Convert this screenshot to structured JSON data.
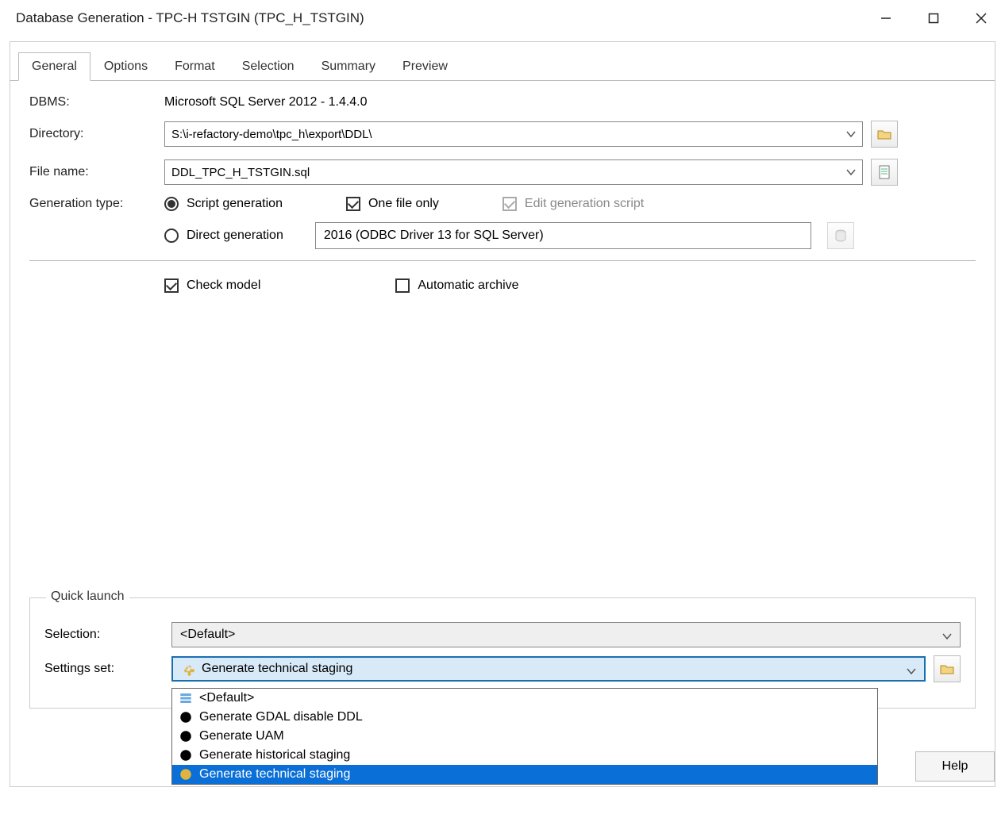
{
  "window": {
    "title": "Database Generation - TPC-H TSTGIN (TPC_H_TSTGIN)"
  },
  "tabs": {
    "general": "General",
    "options": "Options",
    "format": "Format",
    "selection": "Selection",
    "summary": "Summary",
    "preview": "Preview"
  },
  "general": {
    "dbms_label": "DBMS:",
    "dbms_value": "Microsoft SQL Server 2012 - 1.4.4.0",
    "directory_label": "Directory:",
    "directory_value": "S:\\i-refactory-demo\\tpc_h\\export\\DDL\\",
    "filename_label": "File name:",
    "filename_value": "DDL_TPC_H_TSTGIN.sql",
    "gentype_label": "Generation type:",
    "script_gen_label": "Script generation",
    "one_file_label": "One file only",
    "edit_script_label": "Edit generation script",
    "direct_gen_label": "Direct generation",
    "odbc_value": "2016 (ODBC Driver 13 for SQL Server)",
    "check_model_label": "Check model",
    "auto_archive_label": "Automatic archive"
  },
  "quicklaunch": {
    "legend": "Quick launch",
    "selection_label": "Selection:",
    "selection_value": "<Default>",
    "settings_label": "Settings set:",
    "settings_value": "Generate technical staging",
    "options": {
      "default": "<Default>",
      "gdal": "Generate GDAL disable DDL",
      "uam": "Generate UAM",
      "hist": "Generate historical staging",
      "tech": "Generate technical staging"
    }
  },
  "buttons": {
    "help": "Help"
  }
}
